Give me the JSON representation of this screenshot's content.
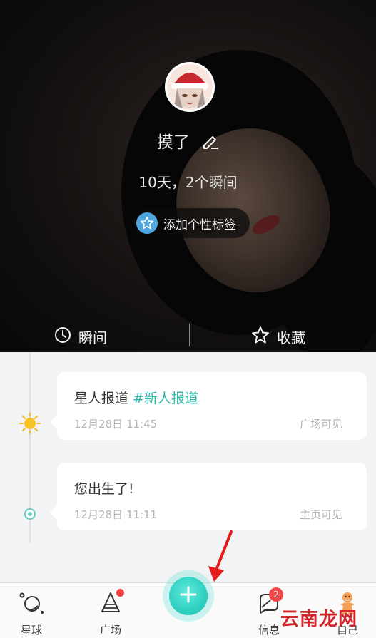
{
  "profile": {
    "nickname": "摸了",
    "stats": "10天，2个瞬间",
    "tag_button": "添加个性标签"
  },
  "tabs": {
    "moments": "瞬间",
    "favorites": "收藏"
  },
  "timeline": [
    {
      "title": "星人报道",
      "hashtag": "#新人报道",
      "time": "12月28日 11:45",
      "visibility": "广场可见",
      "marker": "sun-icon"
    },
    {
      "title": "您出生了!",
      "time": "12月28日 11:11",
      "visibility": "主页可见",
      "marker": "dot-icon"
    }
  ],
  "bottom_nav": {
    "planet": "星球",
    "square": "广场",
    "messages": "信息",
    "messages_badge": "2",
    "self": "自己"
  },
  "watermark": "云南龙网",
  "colors": {
    "accent": "#2ab8aa",
    "fab": "#2fd0c0",
    "badge": "#f04848",
    "tag_icon": "#4ea6df",
    "arrow": "#e21b1b"
  }
}
